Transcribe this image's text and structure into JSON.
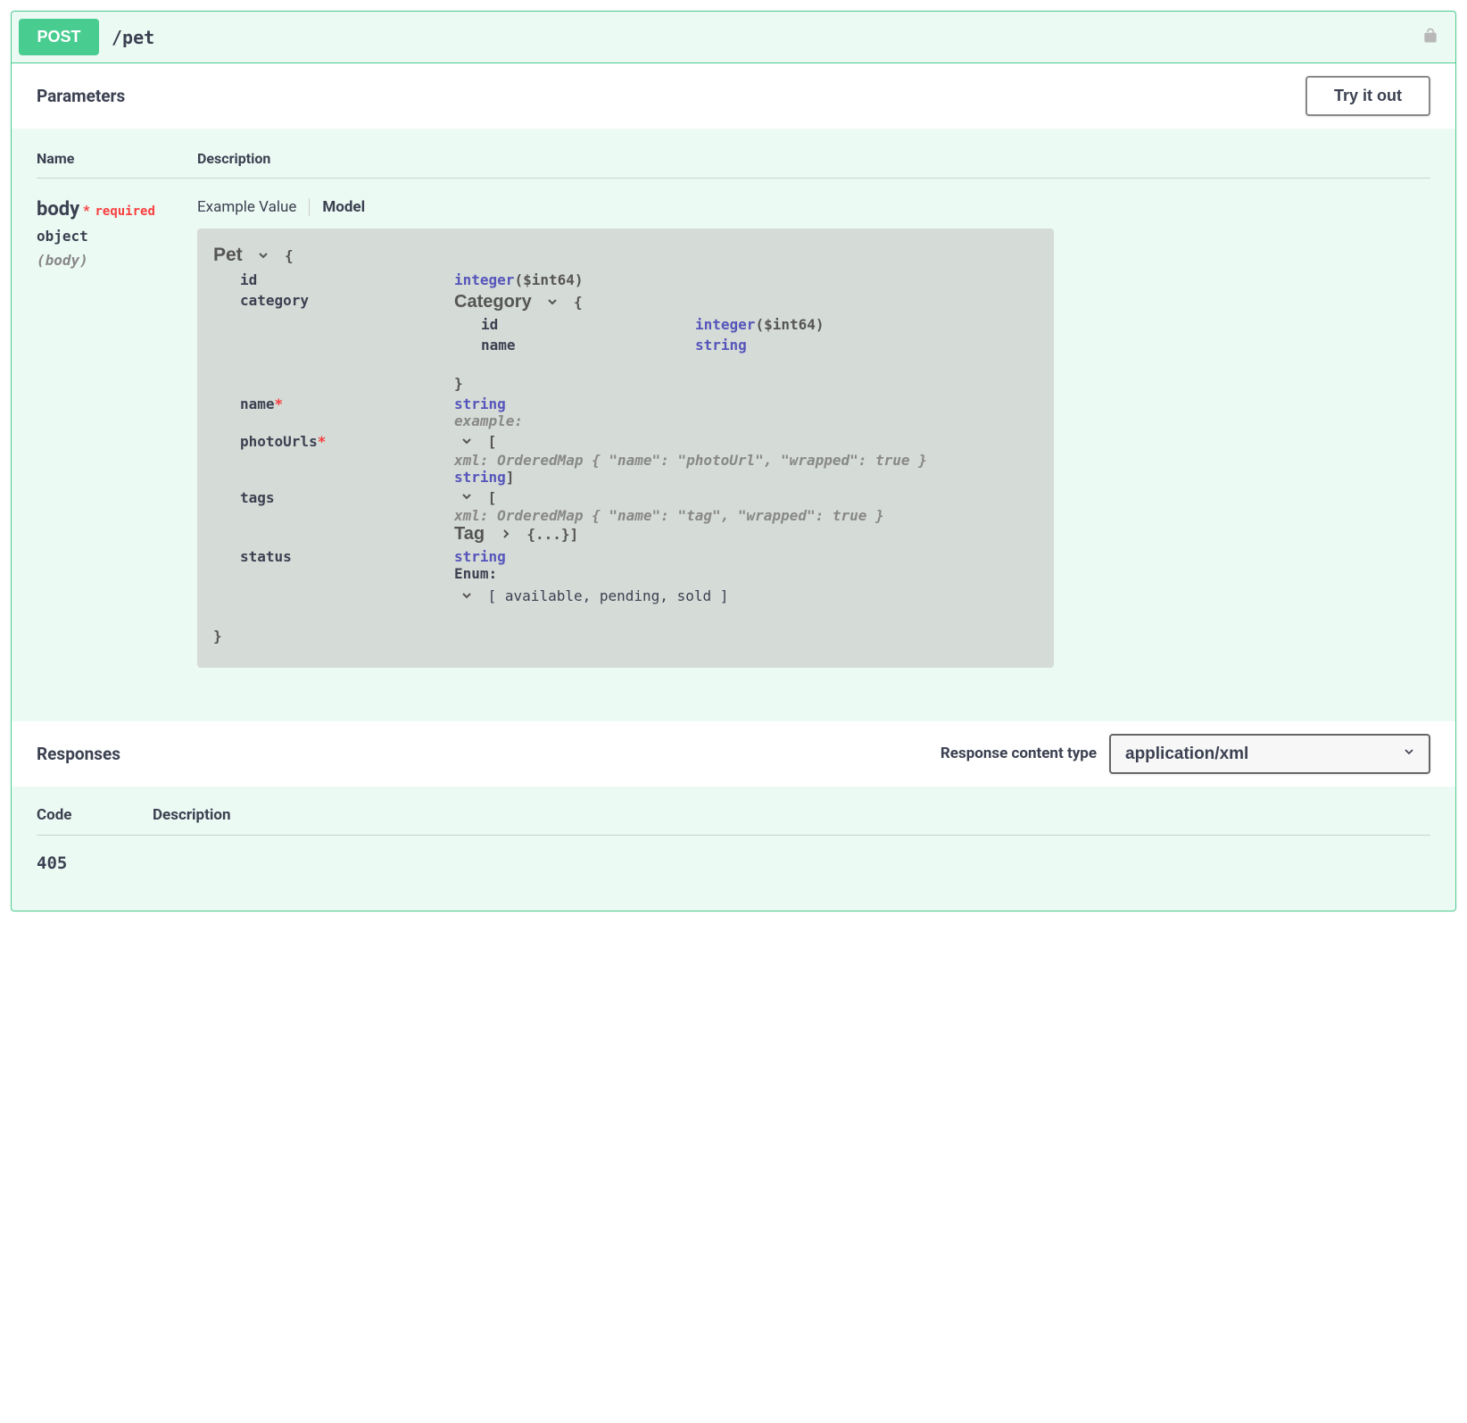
{
  "method": "POST",
  "path": "/pet",
  "parameters_title": "Parameters",
  "try_it_out": "Try it out",
  "headers": {
    "name": "Name",
    "desc": "Description"
  },
  "param": {
    "name": "body",
    "required_star": "*",
    "required_text": "required",
    "type": "object",
    "in": "(body)"
  },
  "tabs": {
    "example": "Example Value",
    "model": "Model"
  },
  "model": {
    "pet": "Pet",
    "brace_open": "{",
    "brace_close": "}",
    "id": "id",
    "id_type": "integer",
    "id_format": "($int64)",
    "category": "category",
    "category_title": "Category",
    "cat_id": "id",
    "cat_id_type": "integer",
    "cat_id_format": "($int64)",
    "cat_name": "name",
    "cat_name_type": "string",
    "name": "name",
    "name_type": "string",
    "example_label": "example:",
    "photoUrls": "photoUrls",
    "photo_bracket": "[",
    "photo_xml": "xml: OrderedMap { \"name\": \"photoUrl\", \"wrapped\": true }",
    "photo_type": "string",
    "photo_close": "]",
    "tags": "tags",
    "tags_bracket": "[",
    "tags_xml": "xml: OrderedMap { \"name\": \"tag\", \"wrapped\": true }",
    "tag_title": "Tag",
    "tag_collapsed": "{...}]",
    "status": "status",
    "status_type": "string",
    "enum_label": "Enum:",
    "enum_values": "[ available, pending, sold ]"
  },
  "responses_title": "Responses",
  "rct_label": "Response content type",
  "content_type": "application/xml",
  "resp_headers": {
    "code": "Code",
    "desc": "Description"
  },
  "resp_code": "405"
}
